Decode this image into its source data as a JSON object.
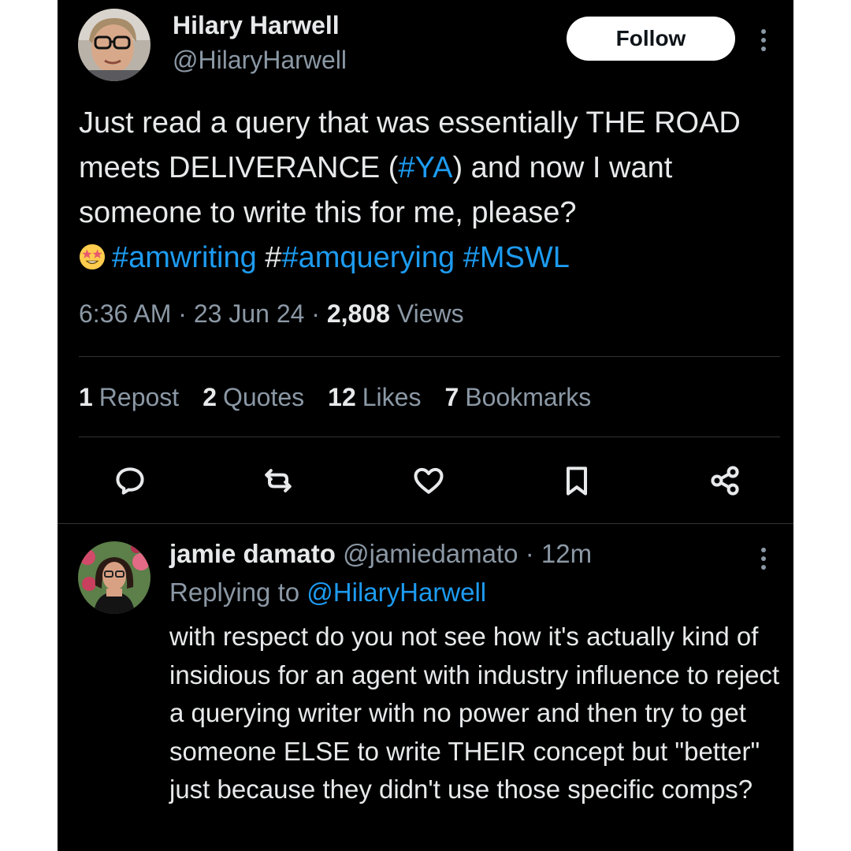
{
  "tweet": {
    "author_name": "Hilary Harwell",
    "author_handle": "@HilaryHarwell",
    "follow_label": "Follow",
    "text_part1": "Just read a query that was essentially THE ROAD meets DELIVERANCE (",
    "tag_ya": "#YA",
    "text_part2": ") and now I want someone to write this for me, please?",
    "emoji": "star-struck-emoji",
    "tag_amwriting": "#amwriting",
    "tag_prefix_hash": "#",
    "tag_amquerying": "#amquerying",
    "tag_mswl": "#MSWL",
    "time": "6:36 AM",
    "date": "23 Jun 24",
    "sep": "·",
    "views_count": "2,808",
    "views_label": "Views",
    "stats": [
      {
        "count": "1",
        "label": "Repost"
      },
      {
        "count": "2",
        "label": "Quotes"
      },
      {
        "count": "12",
        "label": "Likes"
      },
      {
        "count": "7",
        "label": "Bookmarks"
      }
    ],
    "actions": [
      "reply-icon",
      "retweet-icon",
      "like-icon",
      "bookmark-icon",
      "share-icon"
    ]
  },
  "reply": {
    "author_name": "jamie damato",
    "author_handle": "@jamiedamato",
    "time": "· 12m",
    "replying_prefix": "Replying to",
    "replying_to": "@HilaryHarwell",
    "text": "with respect do you not see how it's actually kind of insidious for an agent with industry influence to reject a querying writer with no power and then try to get someone ELSE to write THEIR concept but \"better\" just because they didn't use those specific comps?"
  },
  "colors": {
    "background": "#000000",
    "text": "#e7e9ea",
    "secondary": "#8b98a5",
    "link": "#1d9bf0",
    "divider": "#2f3336"
  }
}
